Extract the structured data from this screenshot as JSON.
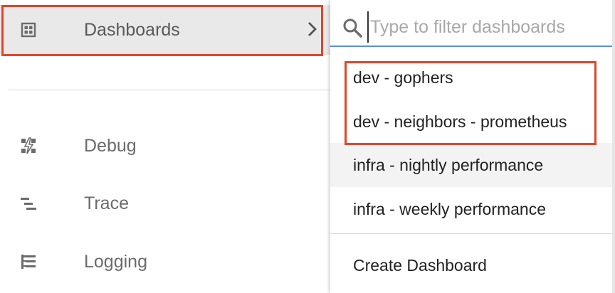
{
  "nav": {
    "dashboards": {
      "label": "Dashboards",
      "icon": "dashboard-grid-icon"
    },
    "debug": {
      "label": "Debug",
      "icon": "debug-icon"
    },
    "trace": {
      "label": "Trace",
      "icon": "trace-icon"
    },
    "logging": {
      "label": "Logging",
      "icon": "logging-icon"
    }
  },
  "dropdown": {
    "search": {
      "placeholder": "Type to filter dashboards",
      "value": ""
    },
    "items": [
      {
        "label": "dev - gophers"
      },
      {
        "label": "dev - neighbors - prometheus"
      },
      {
        "label": "infra - nightly performance"
      },
      {
        "label": "infra - weekly performance"
      }
    ],
    "create_label": "Create Dashboard"
  },
  "colors": {
    "highlight": "#e0452b",
    "search_underline": "#5b8de0",
    "active_background": "#e9e9e9"
  }
}
